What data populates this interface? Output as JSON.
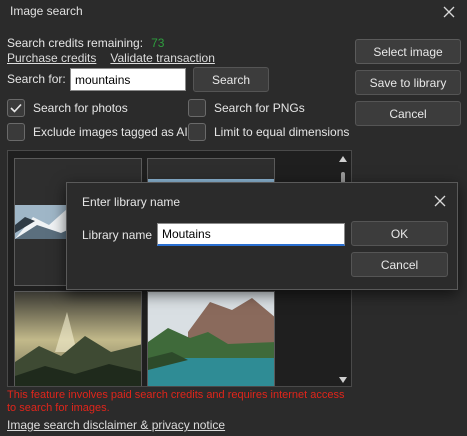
{
  "window": {
    "title": "Image search"
  },
  "credits": {
    "label": "Search credits remaining:",
    "count": "73"
  },
  "links": {
    "purchase": "Purchase credits",
    "validate": "Validate transaction"
  },
  "search": {
    "label": "Search for:",
    "value": "mountains",
    "button": "Search"
  },
  "side_buttons": {
    "select": "Select image",
    "save": "Save to library",
    "cancel": "Cancel"
  },
  "options": {
    "photos": {
      "label": "Search for photos",
      "checked": true
    },
    "pngs": {
      "label": "Search for PNGs",
      "checked": false
    },
    "exclude_ai": {
      "label": "Exclude images tagged as AI",
      "checked": false
    },
    "equal_dims": {
      "label": "Limit to equal dimensions",
      "checked": false
    }
  },
  "notice": "This feature involves paid search credits and requires internet access to search for images.",
  "privacy_link": "Image search disclaimer & privacy notice",
  "dialog": {
    "title": "Enter library name",
    "label": "Library name",
    "value": "Moutains",
    "ok": "OK",
    "cancel": "Cancel"
  }
}
